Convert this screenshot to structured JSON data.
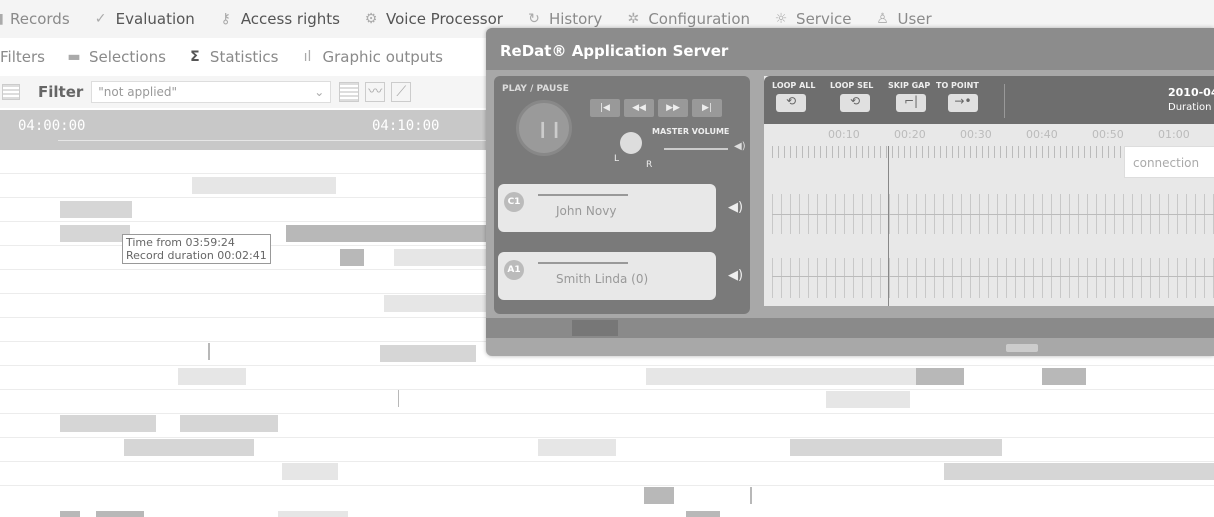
{
  "menu": {
    "items": [
      {
        "label": "Records",
        "icon": "records-icon",
        "glyph": "▮"
      },
      {
        "label": "Evaluation",
        "icon": "evaluation-icon",
        "glyph": "✓"
      },
      {
        "label": "Access rights",
        "icon": "access-rights-icon",
        "glyph": "⚷"
      },
      {
        "label": "Voice Processor",
        "icon": "voice-processor-icon",
        "glyph": "⚙"
      },
      {
        "label": "History",
        "icon": "history-icon",
        "glyph": "↻"
      },
      {
        "label": "Configuration",
        "icon": "configuration-icon",
        "glyph": "✲"
      },
      {
        "label": "Service",
        "icon": "service-icon",
        "glyph": "☼"
      },
      {
        "label": "User",
        "icon": "user-icon",
        "glyph": "♙"
      }
    ]
  },
  "submenu": {
    "filters": "Filters",
    "selections": "Selections",
    "statistics": "Statistics",
    "statistics_glyph": "Σ",
    "graphic": "Graphic outputs",
    "graphic_glyph": "ıl"
  },
  "filter": {
    "label": "Filter",
    "value": "\"not applied\""
  },
  "timeline": {
    "t1": "04:00:00",
    "t2": "04:10:00"
  },
  "tooltip": {
    "line1": "Time from 03:59:24",
    "line2": "Record duration 00:02:41"
  },
  "player": {
    "title": "ReDat® Application Server",
    "play_pause": "PLAY / PAUSE",
    "master_volume": "MASTER VOLUME",
    "left": "L",
    "right": "R",
    "channels": [
      {
        "badge": "C1",
        "name": "John Novy"
      },
      {
        "badge": "A1",
        "name": "Smith Linda (0)"
      }
    ],
    "tools": [
      "LOOP ALL",
      "LOOP SEL",
      "SKIP GAP",
      "TO POINT"
    ],
    "date": "2010-04",
    "duration": "Duration",
    "ticks": [
      "00:10",
      "00:20",
      "00:30",
      "00:40",
      "00:50",
      "01:00"
    ],
    "connection": "connection"
  }
}
